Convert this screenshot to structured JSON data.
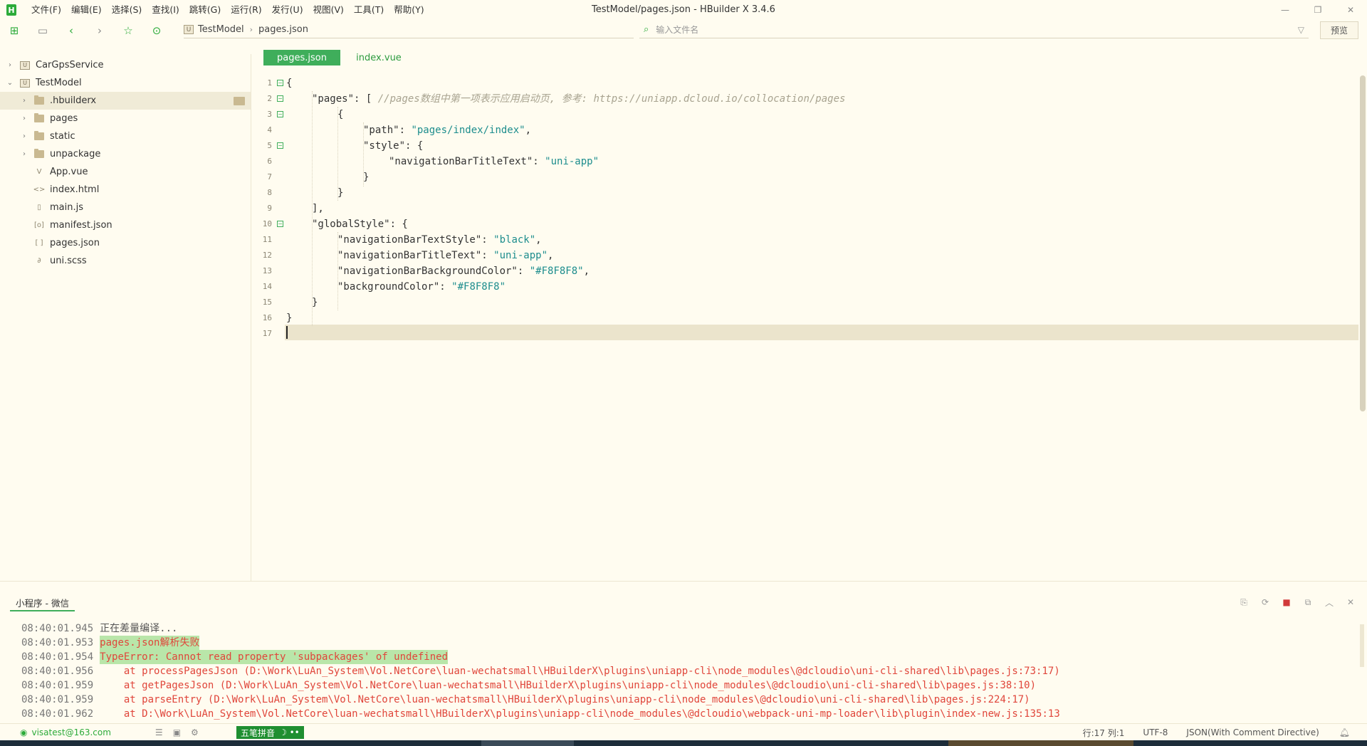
{
  "app": {
    "logo": "H",
    "window_title": "TestModel/pages.json - HBuilder X 3.4.6"
  },
  "menu": [
    {
      "label": "文件(F)"
    },
    {
      "label": "编辑(E)"
    },
    {
      "label": "选择(S)"
    },
    {
      "label": "查找(I)"
    },
    {
      "label": "跳转(G)"
    },
    {
      "label": "运行(R)"
    },
    {
      "label": "发行(U)"
    },
    {
      "label": "视图(V)"
    },
    {
      "label": "工具(T)"
    },
    {
      "label": "帮助(Y)"
    }
  ],
  "toolbar": {
    "breadcrumb_icon": "U",
    "breadcrumb": [
      "TestModel",
      "pages.json"
    ],
    "file_search_placeholder": "输入文件名",
    "preview_label": "预览"
  },
  "sidebar": {
    "projects": [
      {
        "name": "CarGpsService",
        "expanded": false
      },
      {
        "name": "TestModel",
        "expanded": true
      }
    ],
    "items": [
      {
        "name": ".hbuilderx",
        "type": "folder",
        "selected": true
      },
      {
        "name": "pages",
        "type": "folder"
      },
      {
        "name": "static",
        "type": "folder"
      },
      {
        "name": "unpackage",
        "type": "folder"
      },
      {
        "name": "App.vue",
        "type": "vue",
        "icon": "V"
      },
      {
        "name": "index.html",
        "type": "html",
        "icon": "<>"
      },
      {
        "name": "main.js",
        "type": "js",
        "icon": "▯"
      },
      {
        "name": "manifest.json",
        "type": "json",
        "icon": "[o]"
      },
      {
        "name": "pages.json",
        "type": "json",
        "icon": "[ ]"
      },
      {
        "name": "uni.scss",
        "type": "scss",
        "icon": "∂"
      }
    ]
  },
  "editor": {
    "tabs": [
      {
        "label": "pages.json",
        "active": true
      },
      {
        "label": "index.vue",
        "active": false
      }
    ],
    "line_numbers": [
      "1",
      "2",
      "3",
      "4",
      "5",
      "6",
      "7",
      "8",
      "9",
      "10",
      "11",
      "12",
      "13",
      "14",
      "15",
      "16",
      "17"
    ],
    "code": {
      "l1": "{",
      "l2_key": "\"pages\"",
      "l2_punct": ": [ ",
      "l2_comment": "//pages数组中第一项表示应用启动页, 参考: https://uniapp.dcloud.io/collocation/pages",
      "l3": "{",
      "l4_key": "\"path\"",
      "l4_sep": ": ",
      "l4_val": "\"pages/index/index\"",
      "l4_end": ",",
      "l5_key": "\"style\"",
      "l5_rest": ": {",
      "l6_key": "\"navigationBarTitleText\"",
      "l6_sep": ": ",
      "l6_val": "\"uni-app\"",
      "l7": "}",
      "l8": "}",
      "l9": "],",
      "l10_key": "\"globalStyle\"",
      "l10_rest": ": {",
      "l11_key": "\"navigationBarTextStyle\"",
      "l11_sep": ": ",
      "l11_val": "\"black\"",
      "l11_end": ",",
      "l12_key": "\"navigationBarTitleText\"",
      "l12_sep": ": ",
      "l12_val": "\"uni-app\"",
      "l12_end": ",",
      "l13_key": "\"navigationBarBackgroundColor\"",
      "l13_sep": ": ",
      "l13_val": "\"#F8F8F8\"",
      "l13_end": ",",
      "l14_key": "\"backgroundColor\"",
      "l14_sep": ": ",
      "l14_val": "\"#F8F8F8\"",
      "l15": "}",
      "l16": "}"
    }
  },
  "console": {
    "tab_label": "小程序 - 微信",
    "logs": [
      {
        "time": "08:40:01.945",
        "msg": "正在差量编译..."
      },
      {
        "time": "08:40:01.953",
        "msg": "pages.json解析失败"
      },
      {
        "time": "08:40:01.954",
        "msg": "TypeError: Cannot read property 'subpackages' of undefined"
      },
      {
        "time": "08:40:01.956",
        "msg": "    at processPagesJson (D:\\Work\\LuAn_System\\Vol.NetCore\\luan-wechatsmall\\HBuilderX\\plugins\\uniapp-cli\\node_modules\\@dcloudio\\uni-cli-shared\\lib\\pages.js:73:17)"
      },
      {
        "time": "08:40:01.959",
        "msg": "    at getPagesJson (D:\\Work\\LuAn_System\\Vol.NetCore\\luan-wechatsmall\\HBuilderX\\plugins\\uniapp-cli\\node_modules\\@dcloudio\\uni-cli-shared\\lib\\pages.js:38:10)"
      },
      {
        "time": "08:40:01.959",
        "msg": "    at parseEntry (D:\\Work\\LuAn_System\\Vol.NetCore\\luan-wechatsmall\\HBuilderX\\plugins\\uniapp-cli\\node_modules\\@dcloudio\\uni-cli-shared\\lib\\pages.js:224:17)"
      },
      {
        "time": "08:40:01.962",
        "msg": "    at D:\\Work\\LuAn_System\\Vol.NetCore\\luan-wechatsmall\\HBuilderX\\plugins\\uniapp-cli\\node_modules\\@dcloudio\\webpack-uni-mp-loader\\lib\\plugin\\index-new.js:135:13"
      }
    ]
  },
  "statusbar": {
    "user_email": "visatest@163.com",
    "ime_label": "五笔拼音",
    "ime_extra": "☽ ••",
    "line_col": "行:17  列:1",
    "encoding": "UTF-8",
    "language": "JSON(With Comment Directive)"
  },
  "colors": {
    "accent": "#3fae5b",
    "background": "#fffcf0",
    "error": "#e0463b",
    "error_highlight": "#b9e6a9",
    "string": "#1d8d8d"
  }
}
